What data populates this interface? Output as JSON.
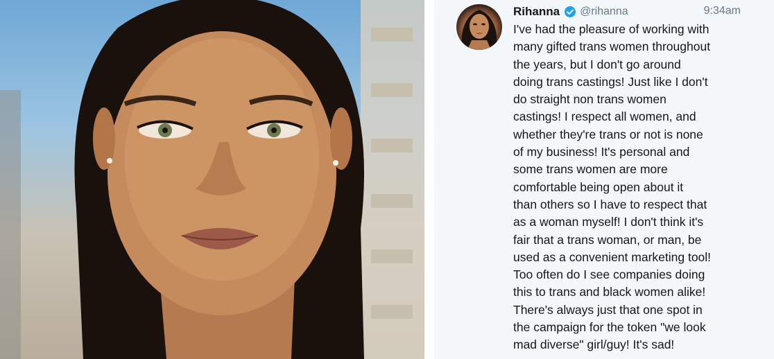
{
  "tweet": {
    "author_name": "Rihanna",
    "handle": "@rihanna",
    "verified_icon": "verified-badge-icon",
    "time": "9:34am",
    "lines": [
      "I've had the pleasure of working with",
      "many gifted trans women throughout",
      "the years, but I don't go around",
      "doing trans castings! Just like I don't",
      "do straight non trans women",
      "castings! I respect all women, and",
      "whether they're trans or not is none",
      "of my business! It's personal and",
      "some trans women are more",
      "comfortable being open about it",
      "than others so I have to respect that",
      "as a woman myself! I don't think it's",
      "fair that a trans woman, or man, be",
      "used as a convenient marketing tool!",
      "Too often do I see companies doing",
      "this to trans and black women alike!",
      "There's always just that one spot in",
      "the campaign for the token \"we look",
      "mad diverse\" girl/guy! It's sad!"
    ]
  },
  "colors": {
    "name": "#14171a",
    "secondary": "#657786",
    "verified": "#1da1f2",
    "panel_bg": "#f5f8fa"
  }
}
